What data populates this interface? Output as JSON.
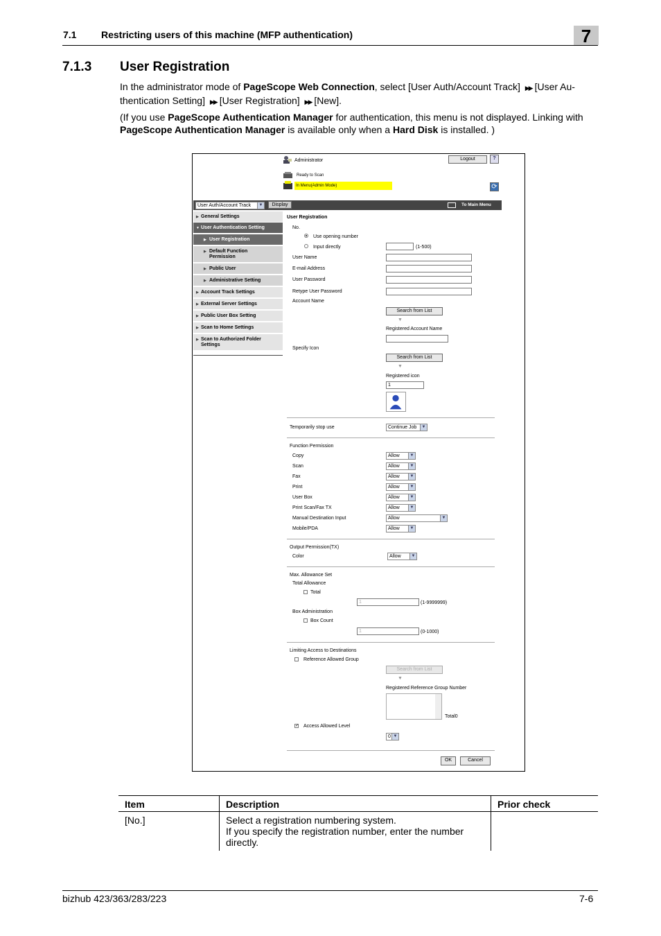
{
  "header": {
    "section_number": "7.1",
    "section_title": "Restricting users of this machine (MFP authentication)",
    "chapter": "7"
  },
  "section": {
    "number": "7.1.3",
    "title": "User Registration"
  },
  "paragraphs": {
    "p1_a": "In the administrator mode of ",
    "p1_b": "PageScope Web Connection",
    "p1_c": ", select [User Auth/Account Track] ",
    "p1_d": "[User Au-thentication Setting] ",
    "p1_e": "[User Registration] ",
    "p1_f": "[New].",
    "p2_a": "(If you use ",
    "p2_b": "PageScope Authentication Manager",
    "p2_c": " for authentication, this menu is not displayed. Linking with ",
    "p2_d": "PageScope Authentication Manager",
    "p2_e": " is available only when a ",
    "p2_f": "Hard Disk",
    "p2_g": " is installed. )",
    "arrow": "▶▶"
  },
  "screenshot": {
    "admin_label": "Administrator",
    "logout": "Logout",
    "help": "?",
    "status_ready": "Ready to Scan",
    "status_mode": "In Menu(Admin Mode)",
    "refresh": "⟳",
    "nav_select": "User Auth/Account Track",
    "display_btn": "Display",
    "to_main_menu": "To Main Menu",
    "menu": [
      {
        "label": "General Settings"
      },
      {
        "label": "User Authentication Setting"
      },
      {
        "label": "User Registration"
      },
      {
        "label": "Default Function\nPermission"
      },
      {
        "label": "Public User"
      },
      {
        "label": "Administrative Setting"
      },
      {
        "label": "Account Track Settings"
      },
      {
        "label": "External Server Settings"
      },
      {
        "label": "Public User Box Setting"
      },
      {
        "label": "Scan to Home Settings"
      },
      {
        "label": "Scan to Authorized Folder\nSettings"
      }
    ],
    "form_title": "User Registration",
    "no_label": "No.",
    "use_opening": "Use opening number",
    "input_directly": "Input directly",
    "range_no": "(1-500)",
    "user_name": "User Name",
    "email": "E-mail Address",
    "user_password": "User Password",
    "retype_password": "Retype User Password",
    "account_name": "Account Name",
    "search_from_list": "Search from List",
    "registered_account": "Registered Account Name",
    "specify_icon": "Specify Icon",
    "registered_icon": "Registered icon",
    "icon_value": "1",
    "temp_stop": "Temporarily stop use",
    "continue_job": "Continue Job",
    "function_permission": "Function Permission",
    "functions": [
      {
        "label": "Copy",
        "value": "Allow"
      },
      {
        "label": "Scan",
        "value": "Allow"
      },
      {
        "label": "Fax",
        "value": "Allow"
      },
      {
        "label": "Print",
        "value": "Allow"
      },
      {
        "label": "User Box",
        "value": "Allow"
      },
      {
        "label": "Print Scan/Fax TX",
        "value": "Allow"
      },
      {
        "label": "Manual Destination Input",
        "value": "Allow"
      },
      {
        "label": "Mobile/PDA",
        "value": "Allow"
      }
    ],
    "output_permission": "Output Permission(TX)",
    "color_label": "Color",
    "color_value": "Allow",
    "max_allowance": "Max. Allowance Set",
    "total_allowance": "Total Allowance",
    "total_label": "Total",
    "total_value": "1",
    "total_range": "(1-9999999)",
    "box_admin": "Box Administration",
    "box_count": "Box Count",
    "box_value": "1",
    "box_range": "(0-1000)",
    "limiting_access": "Limiting Access to Destinations",
    "ref_allowed_group": "Reference Allowed Group",
    "registered_ref_group": "Registered Reference Group Number",
    "total0": "Total0",
    "access_allowed_level": "Access Allowed Level",
    "level_value": "0",
    "ok": "OK",
    "cancel": "Cancel",
    "dd_glyph": "▼",
    "tri_glyph": "▶",
    "tri_down_glyph": "▼",
    "check_glyph": "✓"
  },
  "table": {
    "headers": [
      "Item",
      "Description",
      "Prior check"
    ],
    "rows": [
      {
        "item": "[No.]",
        "description_1": "Select a registration numbering system.",
        "description_2": "If you specify the registration number, enter the number directly.",
        "prior": ""
      }
    ]
  },
  "footer": {
    "model": "bizhub 423/363/283/223",
    "page": "7-6"
  },
  "colors": {
    "status_highlight": "#ffff00",
    "navbar": "#444444",
    "menu_active": "#606060"
  }
}
